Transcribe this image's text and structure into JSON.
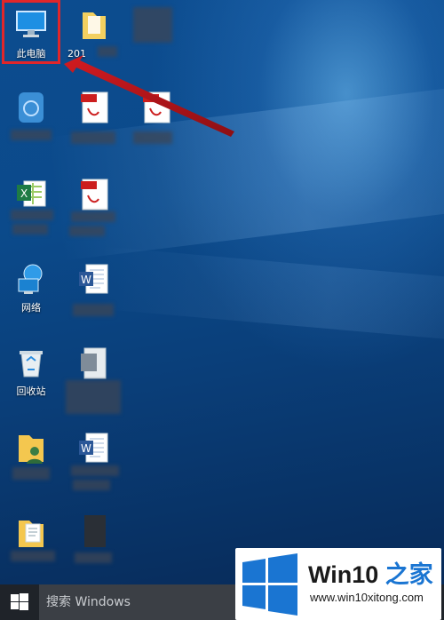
{
  "desktop": {
    "icons": [
      {
        "id": "this-pc",
        "label": "此电脑",
        "highlighted": true
      },
      {
        "id": "folder-2019",
        "label": "201"
      },
      {
        "id": "network",
        "label": "网络"
      },
      {
        "id": "recycle-bin",
        "label": "回收站"
      }
    ],
    "adobe_label": "Adobe",
    "pdf_label": "PDF"
  },
  "taskbar": {
    "search_placeholder": "搜索 Windows"
  },
  "watermark": {
    "brand": "Win10",
    "brand_suffix": "之家",
    "url": "www.win10xitong.com"
  },
  "colors": {
    "highlight": "#e0262a",
    "arrow": "#c0161b",
    "win_blue": "#1a75d2"
  }
}
